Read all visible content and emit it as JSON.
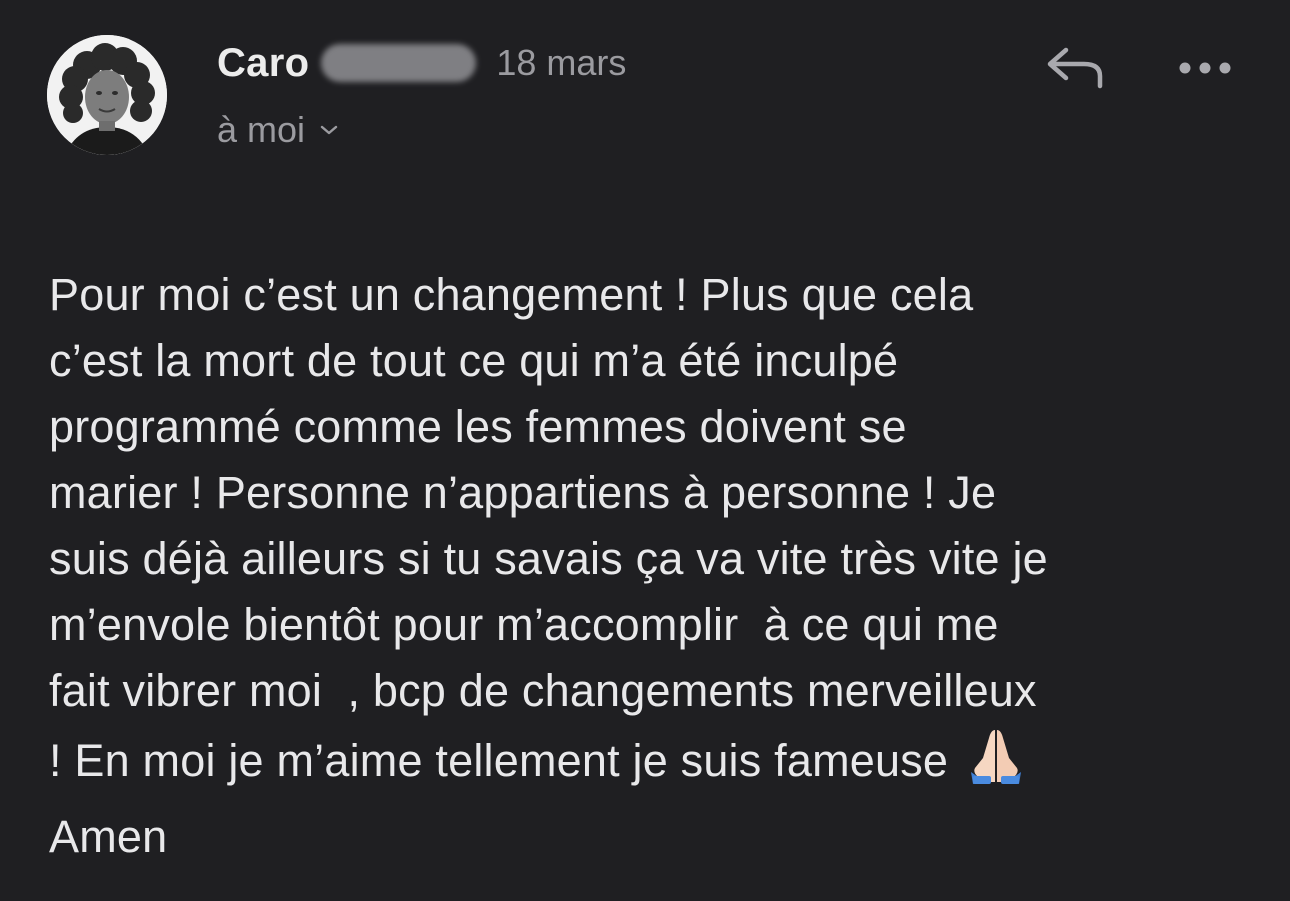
{
  "header": {
    "sender_name": "Caro",
    "date": "18 mars",
    "recipient": "à moi"
  },
  "icons": {
    "reply": "reply-arrow-icon",
    "more": "more-horizontal-icon",
    "recipient_toggle": "chevron-down-icon",
    "emoji": "folded-hands-emoji"
  },
  "message": {
    "lines": [
      "Pour moi c’est un changement ! Plus que cela",
      "c’est la mort de tout ce qui m’a été inculpé",
      "programmé comme les femmes doivent se",
      "marier ! Personne n’appartiens à personne ! Je",
      "suis déjà ailleurs si tu savais ça va vite très vite je",
      "m’envole bientôt pour m’accomplir  à ce qui me",
      "fait vibrer moi  , bcp de changements merveilleux",
      "! En moi je m’aime tellement je suis fameuse",
      "Amen"
    ]
  },
  "colors": {
    "background": "#1f1f22",
    "primary_text": "#e8e8ea",
    "secondary_text": "#9b9ba0"
  }
}
